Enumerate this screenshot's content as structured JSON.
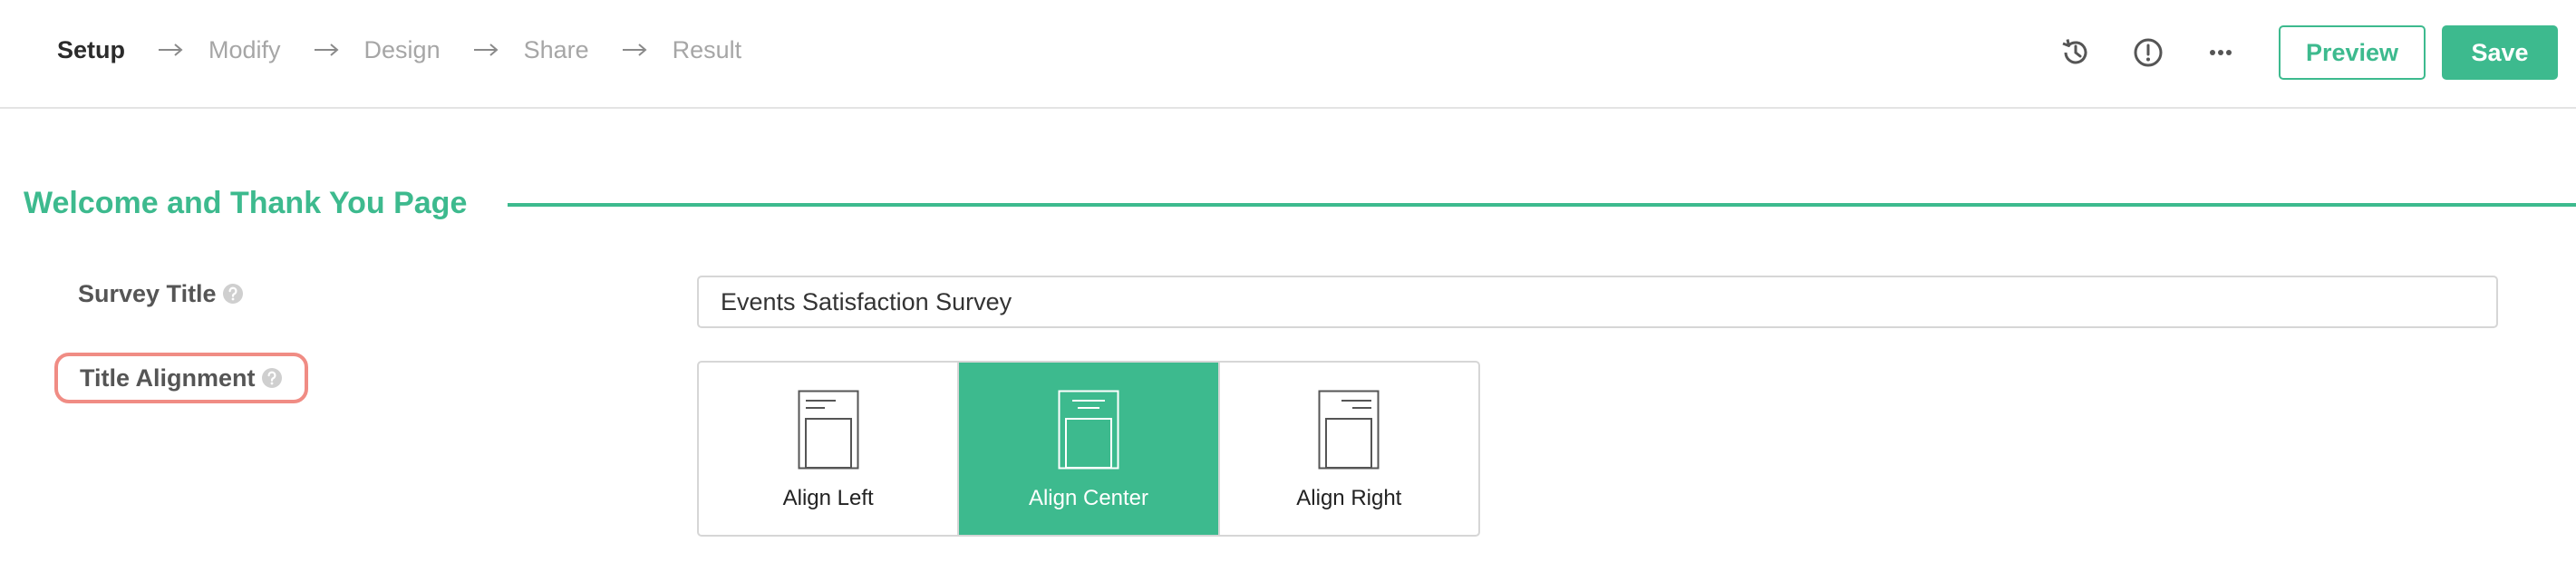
{
  "nav": {
    "steps": [
      {
        "label": "Setup",
        "active": true
      },
      {
        "label": "Modify",
        "active": false
      },
      {
        "label": "Design",
        "active": false
      },
      {
        "label": "Share",
        "active": false
      },
      {
        "label": "Result",
        "active": false
      }
    ],
    "icons": [
      "history-icon",
      "alert-circle-icon",
      "more-horizontal-icon"
    ],
    "preview_label": "Preview",
    "save_label": "Save"
  },
  "section": {
    "title": "Welcome and Thank You Page"
  },
  "fields": {
    "survey_title": {
      "label": "Survey Title",
      "value": "Events Satisfaction Survey"
    },
    "title_alignment": {
      "label": "Title Alignment",
      "options": [
        {
          "label": "Align Left",
          "selected": false
        },
        {
          "label": "Align Center",
          "selected": true
        },
        {
          "label": "Align Right",
          "selected": false
        }
      ]
    }
  },
  "colors": {
    "accent": "#3dba8e",
    "highlight": "#f08c84",
    "muted": "#a6a6a6"
  }
}
